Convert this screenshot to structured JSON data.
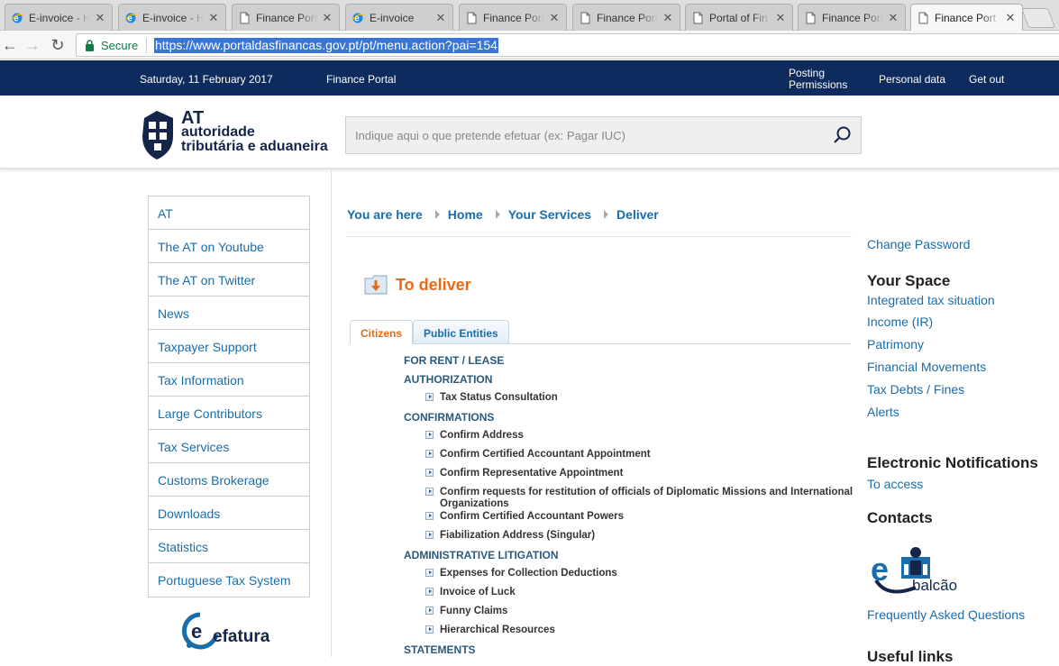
{
  "browser": {
    "tabs": [
      {
        "title": "E-invoice - H",
        "icon": "ie-icon"
      },
      {
        "title": "E-invoice - H",
        "icon": "ie-icon"
      },
      {
        "title": "Finance Port",
        "icon": "page-icon"
      },
      {
        "title": "E-invoice",
        "icon": "ie-icon"
      },
      {
        "title": "Finance Port",
        "icon": "page-icon"
      },
      {
        "title": "Finance Port",
        "icon": "page-icon"
      },
      {
        "title": "Portal of Fin",
        "icon": "page-icon"
      },
      {
        "title": "Finance Port",
        "icon": "page-icon"
      },
      {
        "title": "Finance Port",
        "icon": "page-icon"
      }
    ],
    "secure_label": "Secure",
    "url": "https://www.portaldasfinancas.gov.pt/pt/menu.action?pai=154"
  },
  "topbar": {
    "date": "Saturday, 11 February 2017",
    "portal": "Finance Portal",
    "posting": "Posting Permissions",
    "personal": "Personal data",
    "getout": "Get out"
  },
  "header": {
    "logo_line1": "AT",
    "logo_line2": "autoridade",
    "logo_line3": "tributária e aduaneira",
    "search_placeholder": "Indique aqui o que pretende efetuar (ex: Pagar IUC)"
  },
  "sidebar": {
    "items": [
      "AT",
      "The AT on Youtube",
      "The AT on Twitter",
      "News",
      "Taxpayer Support",
      "Tax Information",
      "Large Contributors",
      "Tax Services",
      "Customs Brokerage",
      "Downloads",
      "Statistics",
      "Portuguese Tax System"
    ],
    "efatura_logo": "efatura"
  },
  "breadcrumb": {
    "here": "You are here",
    "home": "Home",
    "services": "Your Services",
    "deliver": "Deliver"
  },
  "main": {
    "title": "To deliver",
    "tabs": [
      "Citizens",
      "Public Entities"
    ],
    "sections": [
      {
        "title": "FOR RENT / LEASE",
        "items": []
      },
      {
        "title": "AUTHORIZATION",
        "items": [
          "Tax Status Consultation"
        ]
      },
      {
        "title": "CONFIRMATIONS",
        "items": [
          "Confirm Address",
          "Confirm Certified Accountant Appointment",
          "Confirm Representative Appointment",
          "Confirm requests for restitution of officials of Diplomatic Missions and International Organizations",
          "Confirm Certified Accountant Powers",
          "Fiabilization Address (Singular)"
        ]
      },
      {
        "title": "ADMINISTRATIVE LITIGATION",
        "items": [
          "Expenses for Collection Deductions",
          "Invoice of Luck",
          "Funny Claims",
          "Hierarchical Resources"
        ]
      },
      {
        "title": "STATEMENTS",
        "items": []
      }
    ]
  },
  "right": {
    "change_password": "Change Password",
    "your_space": "Your Space",
    "space_links": [
      "Integrated tax situation",
      "Income (IR)",
      "Patrimony",
      "Financial Movements",
      "Tax Debts / Fines",
      "Alerts"
    ],
    "notifications_title": "Electronic Notifications",
    "notifications_link": "To access",
    "contacts_title": "Contacts",
    "ebalcao_logo": "balcão",
    "faq": "Frequently Asked Questions",
    "useful_links_title": "Useful links"
  }
}
